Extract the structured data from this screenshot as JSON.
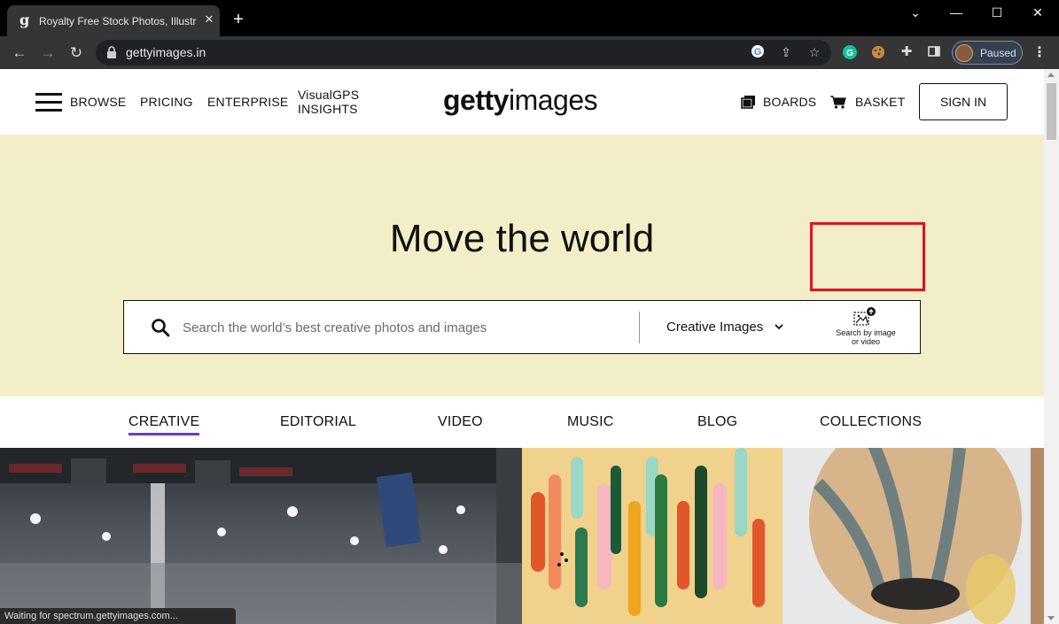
{
  "browser": {
    "tab_title": "Royalty Free Stock Photos, Illustrations",
    "tab_favicon": "g",
    "url": "gettyimages.in",
    "profile_status": "Paused",
    "status_text": "Waiting for spectrum.gettyimages.com..."
  },
  "header": {
    "nav": {
      "browse": "BROWSE",
      "pricing": "PRICING",
      "enterprise": "ENTERPRISE",
      "visualgps_line1": "VisualGPS",
      "visualgps_line2": "INSIGHTS"
    },
    "logo": {
      "bold": "getty",
      "light": "images"
    },
    "boards": "BOARDS",
    "basket": "BASKET",
    "sign_in": "SIGN IN"
  },
  "hero": {
    "title": "Move the world",
    "search_placeholder": "Search the world’s best creative photos and images",
    "search_type": "Creative Images",
    "visual_search_line1": "Search by image",
    "visual_search_line2": "or video"
  },
  "content_tabs": [
    "CREATIVE",
    "EDITORIAL",
    "VIDEO",
    "MUSIC",
    "BLOG",
    "COLLECTIONS"
  ],
  "colors": {
    "hero_bg": "#f2eec8",
    "active_tab_underline": "#6a3fb5",
    "highlight_box": "#e2121d",
    "chrome_dark": "#353535"
  },
  "icons": {
    "search": "search-icon",
    "boards": "boards-icon",
    "basket": "cart-icon",
    "visual_search": "image-upload-icon"
  }
}
